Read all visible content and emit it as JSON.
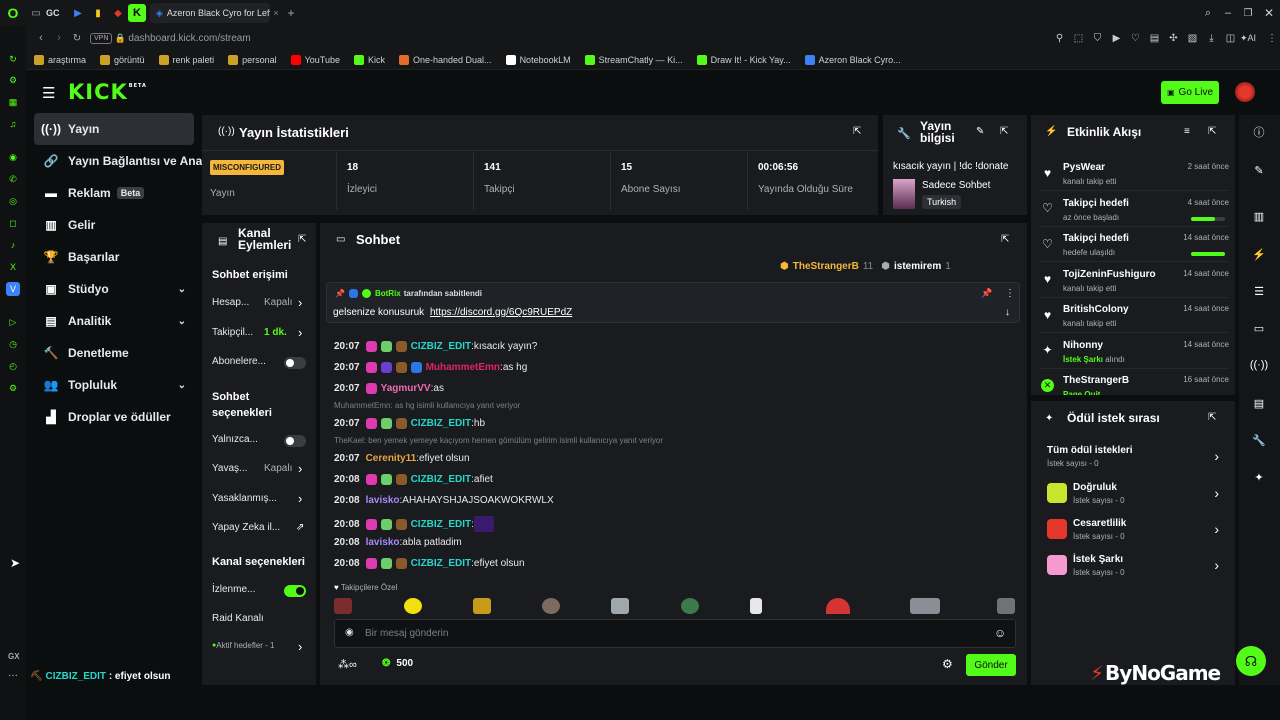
{
  "browser": {
    "tab_title": "Azeron Black Cyro for Left...",
    "tab_prefix": "GC",
    "address": "dashboard.kick.com/stream",
    "vpn_label": "VPN",
    "ai_label": "AI",
    "new_tab": "+"
  },
  "bookmarks": [
    "araştırma",
    "görüntü",
    "renk paleti",
    "personal",
    "YouTube",
    "Kick",
    "One-handed Dual...",
    "NotebookLM",
    "StreamChatly — Ki...",
    "Draw It! - Kick Yay...",
    "Azeron Black Cyro..."
  ],
  "bookmark_colors": [
    "#c9a227",
    "#c9a227",
    "#c9a227",
    "#c9a227",
    "#ff0000",
    "#53fc18",
    "#e56b28",
    "#ffffff",
    "#53fc18",
    "#53fc18",
    "#3b82f6"
  ],
  "header": {
    "logo": "KICK",
    "logo_sup": "BETA",
    "go_live": "Go Live"
  },
  "sidebar": {
    "items": [
      {
        "label": "Yayın",
        "icon": "stream-icon",
        "glyph": "((·))",
        "active": true
      },
      {
        "label": "Yayın Bağlantısı ve Anahtar",
        "icon": "link-icon",
        "glyph": "🔗"
      },
      {
        "label": "Reklam",
        "icon": "ads-icon",
        "glyph": "▬",
        "badge": "Beta"
      },
      {
        "label": "Gelir",
        "icon": "revenue-icon",
        "glyph": "▥"
      },
      {
        "label": "Başarılar",
        "icon": "trophy-icon",
        "glyph": "🏆"
      },
      {
        "label": "Stüdyo",
        "icon": "studio-icon",
        "glyph": "▣",
        "chevron": "⌄"
      },
      {
        "label": "Analitik",
        "icon": "analytics-icon",
        "glyph": "▤",
        "chevron": "⌄"
      },
      {
        "label": "Denetleme",
        "icon": "moderation-icon",
        "glyph": "🔨"
      },
      {
        "label": "Topluluk",
        "icon": "community-icon",
        "glyph": "👥",
        "chevron": "⌄"
      },
      {
        "label": "Droplar ve ödüller",
        "icon": "drops-icon",
        "glyph": "▟"
      }
    ]
  },
  "stats": {
    "title": "Yayın İstatistikleri",
    "status_badge": "MISCONFIGURED",
    "status_label": "Yayın",
    "items": [
      {
        "value": "18",
        "label": "İzleyici"
      },
      {
        "value": "141",
        "label": "Takipçi"
      },
      {
        "value": "15",
        "label": "Abone Sayısı"
      },
      {
        "value": "00:06:56",
        "label": "Yayında Olduğu Süre"
      }
    ]
  },
  "stream_info": {
    "title": "Yayın bilgisi",
    "stream_title": "kısacık yayın | !dc !donate",
    "category": "Sadece Sohbet",
    "language": "Turkish"
  },
  "channel_actions": {
    "title": "Kanal Eylemleri",
    "section1": "Sohbet erişimi",
    "rows1": [
      {
        "label": "Hesap...",
        "value": "Kapalı",
        "kind": "chevron"
      },
      {
        "label": "Takipçil...",
        "value": "1 dk.",
        "kind": "chevron",
        "green": true
      },
      {
        "label": "Abonelere...",
        "kind": "toggle",
        "on": false
      }
    ],
    "section2": "Sohbet seçenekleri",
    "rows2": [
      {
        "label": "Yalnızca...",
        "kind": "toggle",
        "on": false
      },
      {
        "label": "Yavaş...",
        "value": "Kapalı",
        "kind": "chevron"
      },
      {
        "label": "Yasaklanmış...",
        "kind": "chevron"
      },
      {
        "label": "Yapay Zeka il...",
        "kind": "external"
      }
    ],
    "section3": "Kanal seçenekleri",
    "rows3": [
      {
        "label": "İzlenme...",
        "kind": "toggle",
        "on": true
      },
      {
        "label": "Raid Kanalı",
        "kind": "none"
      },
      {
        "label": "Aktif hedefler - 1",
        "kind": "chevron"
      }
    ]
  },
  "chat": {
    "title": "Sohbet",
    "top_gifters": [
      {
        "name": "TheStrangerB",
        "count": "11"
      },
      {
        "name": "istemirem",
        "count": "1"
      }
    ],
    "pinned_by": "BotRix",
    "pinned_suffix": "tarafından sabitlendi",
    "pinned_text": "gelsenize konusuruk",
    "pinned_link": "https://discord.gg/6Qc9RUEPdZ",
    "messages": [
      {
        "time": "20:07",
        "user": "CIZBIZ_EDIT",
        "color": "#25d7c9",
        "text": "kısacık yayın?",
        "badges": [
          "#e03ab0",
          "#6ccf6a",
          "#8a5a2b"
        ]
      },
      {
        "time": "20:07",
        "user": "MuhammetEmn",
        "color": "#e0245e",
        "text": "as hg",
        "badges": [
          "#e03ab0",
          "#6a3fd0",
          "#8a5a2b",
          "#2b78e4"
        ]
      },
      {
        "time": "20:07",
        "user": "YagmurVV",
        "color": "#ef6ab4",
        "text": "as",
        "badges": [
          "#e03ab0"
        ]
      },
      {
        "reply": "MuhammetEmn: as hg isimli kullanıcıya yanıt veriyor"
      },
      {
        "time": "20:07",
        "user": "CIZBIZ_EDIT",
        "color": "#25d7c9",
        "text": "hb",
        "badges": [
          "#e03ab0",
          "#6ccf6a",
          "#8a5a2b"
        ]
      },
      {
        "reply": "TheKael: ben yemek yemeye kaçıyom hemen gömülüm gelirim isimli kullanıcıya yanıt veriyor"
      },
      {
        "time": "20:07",
        "user": "Cerenity11",
        "color": "#e8a33d",
        "text": "efiyet olsun",
        "badges": []
      },
      {
        "time": "20:08",
        "user": "CIZBIZ_EDIT",
        "color": "#25d7c9",
        "text": "afiet",
        "badges": [
          "#e03ab0",
          "#6ccf6a",
          "#8a5a2b"
        ]
      },
      {
        "time": "20:08",
        "user": "lavisko",
        "color": "#a78bfa",
        "text": "AHAHAYSHJAJSOAKWOKRWLX",
        "badges": []
      },
      {
        "time": "20:08",
        "user": "CIZBIZ_EDIT",
        "color": "#25d7c9",
        "text": "",
        "emote": true,
        "badges": [
          "#e03ab0",
          "#6ccf6a",
          "#8a5a2b"
        ]
      },
      {
        "time": "20:08",
        "user": "lavisko",
        "color": "#a78bfa",
        "text": "abla patladim",
        "badges": []
      },
      {
        "time": "20:08",
        "user": "CIZBIZ_EDIT",
        "color": "#25d7c9",
        "text": "efiyet olsun",
        "badges": [
          "#e03ab0",
          "#6ccf6a",
          "#8a5a2b"
        ]
      }
    ],
    "followers_only_label": "Takipçilere Özel",
    "input_placeholder": "Bir mesaj gönderin",
    "points": "500",
    "send": "Gönder"
  },
  "activity": {
    "title": "Etkinlik Akışı",
    "events": [
      {
        "name": "PysWear",
        "sub": "kanalı takip etti",
        "time": "2 saat önce",
        "icon": "heart-icon",
        "glyph": "♥"
      },
      {
        "name": "Takipçi hedefi",
        "sub": "az önce başladı",
        "time": "4 saat önce",
        "icon": "heart-outline-icon",
        "glyph": "♡",
        "progress": 0.7
      },
      {
        "name": "Takipçi hedefi",
        "sub": "hedefe ulaşıldı",
        "time": "14 saat önce",
        "icon": "heart-outline-icon",
        "glyph": "♡",
        "progress": 1.0
      },
      {
        "name": "TojiZeninFushiguro",
        "sub": "kanalı takip etti",
        "time": "14 saat önce",
        "icon": "heart-icon",
        "glyph": "♥"
      },
      {
        "name": "BritishColony",
        "sub": "kanalı takip etti",
        "time": "14 saat önce",
        "icon": "heart-icon",
        "glyph": "♥"
      },
      {
        "name": "Nihonny",
        "sub": "İstek Şarkı",
        "sub2": " alındı",
        "time": "14 saat önce",
        "icon": "reward-icon",
        "glyph": "✦"
      },
      {
        "name": "TheStrangerB",
        "sub": "Page Quit",
        "time": "16 saat önce",
        "icon": "kick-coin-icon",
        "glyph": "✕"
      }
    ]
  },
  "rewards": {
    "title": "Ödül istek sırası",
    "all": {
      "name": "Tüm ödül istekleri",
      "sub": "İstek sayısı - 0"
    },
    "items": [
      {
        "name": "Doğruluk",
        "sub": "İstek sayısı - 0",
        "color": "#c8e62e"
      },
      {
        "name": "Cesaretlilik",
        "sub": "İstek sayısı - 0",
        "color": "#e5372b"
      },
      {
        "name": "İstek Şarkı",
        "sub": "İstek sayısı - 0",
        "color": "#f59ad0"
      }
    ]
  },
  "ticker": {
    "user": "CIZBIZ_EDIT",
    "text": ": efiyet olsun"
  },
  "watermark": "ByNoGame",
  "opera_label": "GX",
  "colors": {
    "accent": "#53fc18",
    "panel": "#191b1f",
    "bg": "#0b0e0f"
  }
}
